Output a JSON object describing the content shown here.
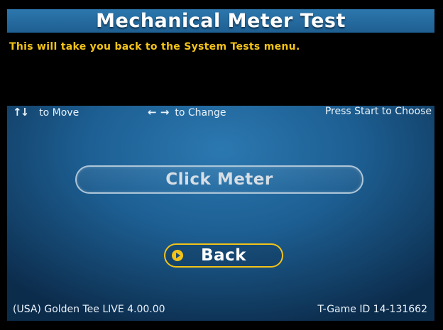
{
  "title": "Mechanical Meter Test",
  "message": "This will take you back to the System Tests menu.",
  "hints": {
    "move_arrows": "↑↓",
    "move": "to Move",
    "change_arrows": "← →",
    "change": "to Change",
    "choose": "Press Start to Choose"
  },
  "menu": {
    "items": [
      {
        "label": "Click Meter",
        "selected": false
      },
      {
        "label": "Back",
        "selected": true
      }
    ]
  },
  "footer": {
    "version": "(USA) Golden Tee LIVE 4.00.00",
    "game_id": "T-Game ID 14-131662"
  },
  "colors": {
    "accent": "#f3c318",
    "background": "#1d5f93",
    "message_bg": "#000000"
  },
  "icons": {
    "move": "up-down-arrows-icon",
    "change": "left-right-arrows-icon",
    "selector": "selection-pointer-icon"
  }
}
